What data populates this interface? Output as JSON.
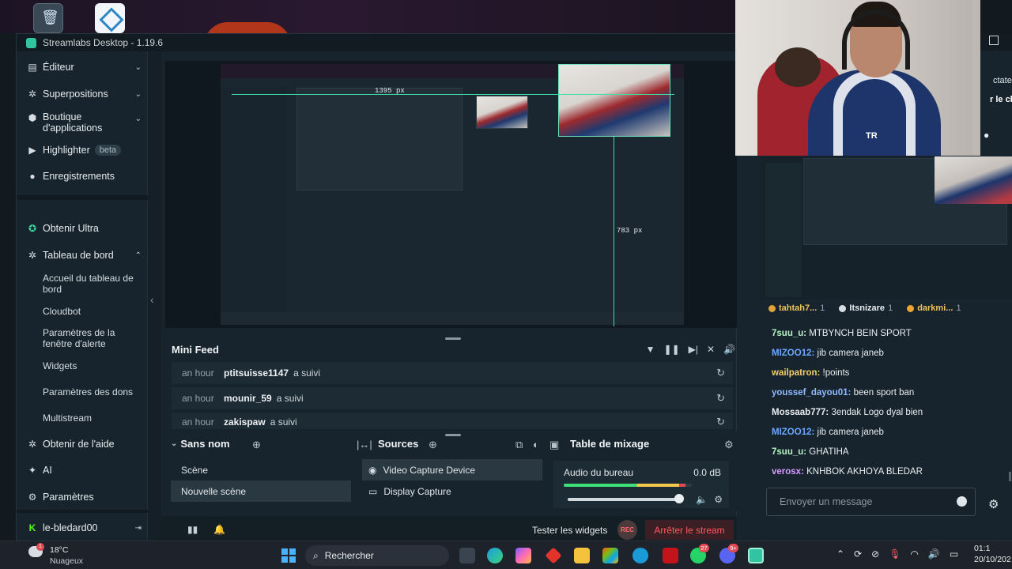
{
  "window": {
    "title": "Streamlabs Desktop - 1.19.6"
  },
  "sidebar": {
    "items": [
      {
        "label": "Éditeur",
        "icon": "editor-icon"
      },
      {
        "label": "Superpositions",
        "icon": "overlays-icon"
      },
      {
        "label": "Boutique d'applications",
        "icon": "app-store-icon"
      },
      {
        "label": "Highlighter",
        "icon": "highlighter-icon",
        "badge": "beta"
      },
      {
        "label": "Enregistrements",
        "icon": "recordings-icon"
      }
    ],
    "ultra": "Obtenir Ultra",
    "dashboard": "Tableau de bord",
    "dashboard_sub": [
      "Accueil du tableau de bord",
      "Cloudbot",
      "Paramètres de la fenêtre d'alerte",
      "Widgets",
      "Paramètres des dons",
      "Multistream"
    ],
    "help": "Obtenir de l'aide",
    "ai": "AI",
    "settings": "Paramètres",
    "account": "le-bledard00"
  },
  "preview": {
    "width_label": "1395 px",
    "height_label": "783 px"
  },
  "mini_feed": {
    "title": "Mini Feed",
    "rows": [
      {
        "time": "an hour",
        "user": "ptitsuisse1147",
        "action": "a suivi"
      },
      {
        "time": "an hour",
        "user": "mounir_59",
        "action": "a suivi"
      },
      {
        "time": "an hour",
        "user": "zakispaw",
        "action": "a suivi"
      }
    ]
  },
  "scenes": {
    "title": "Sans nom",
    "items": [
      "Scène",
      "Nouvelle scène"
    ],
    "selected": "Nouvelle scène"
  },
  "sources": {
    "title": "Sources",
    "items": [
      {
        "label": "Video Capture Device",
        "icon": "camera-icon"
      },
      {
        "label": "Display Capture",
        "icon": "monitor-icon"
      }
    ]
  },
  "mixer": {
    "title": "Table de mixage",
    "channel": "Audio du bureau",
    "db": "0.0 dB",
    "volume_level": 0.95
  },
  "footer": {
    "test_widgets": "Tester les widgets",
    "rec": "REC",
    "stop_stream": "Arrêter le stream"
  },
  "chat": {
    "peek_viewers": "ctateurs",
    "peek_chat": "r le chat",
    "viewers": [
      {
        "name": "tahtah7...",
        "count": "1",
        "dot": "#e0a23a"
      },
      {
        "name": "Itsnizare",
        "count": "1",
        "dot": "#d7dde2"
      },
      {
        "name": "darkmi...",
        "count": "1",
        "dot": "#f0a52e"
      }
    ],
    "messages": [
      {
        "user": "7suu_u:",
        "text": "MTBYNCH BEIN SPORT",
        "color": "#b6f2c4"
      },
      {
        "user": "MIZOO12:",
        "text": "jib camera janeb",
        "color": "#6aa8ff"
      },
      {
        "user": "wailpatron:",
        "text": "!points",
        "color": "#f2d06b"
      },
      {
        "user": "youssef_dayou01:",
        "text": "been sport ban",
        "color": "#8fb8ff"
      },
      {
        "user": "Mossaab777:",
        "text": "3endak Logo dyal bien",
        "color": "#e9eef1"
      },
      {
        "user": "MIZOO12:",
        "text": "jib camera janeb",
        "color": "#6aa8ff"
      },
      {
        "user": "7suu_u:",
        "text": "GHATIHA",
        "color": "#b6f2c4"
      },
      {
        "user": "verosx:",
        "text": "KNHBOK AKHOYA BLEDAR",
        "color": "#d59cff"
      }
    ],
    "input_placeholder": "Envoyer un message"
  },
  "webcam": {
    "jersey_text": "TR"
  },
  "taskbar": {
    "weather_temp": "18°C",
    "weather_cond": "Nuageux",
    "weather_badge": "1",
    "search": "Rechercher",
    "whatsapp_badge": "27",
    "discord_badge": "9+",
    "time": "01:1",
    "date": "20/10/202"
  }
}
